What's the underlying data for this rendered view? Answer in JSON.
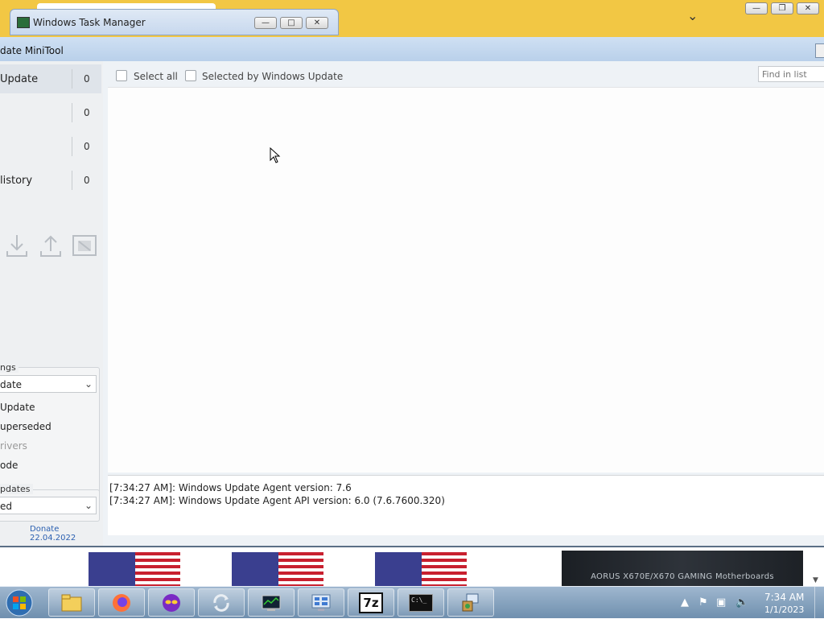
{
  "taskmgr": {
    "title": "Windows Task Manager"
  },
  "app": {
    "title": "date MiniTool",
    "sidebar": {
      "items": [
        {
          "label": " Update",
          "count": "0"
        },
        {
          "label": "",
          "count": "0"
        },
        {
          "label": "",
          "count": "0"
        },
        {
          "label": "listory",
          "count": "0"
        }
      ],
      "settings": {
        "label": "ngs",
        "mode_selected": "date",
        "options": [
          " Update",
          "uperseded",
          "rivers",
          "ode"
        ]
      },
      "updates": {
        "label": "pdates",
        "selected": "ed"
      },
      "donate": "Donate",
      "date": "22.04.2022"
    },
    "toolbar": {
      "select_all": "Select all",
      "selected_by_wu": "Selected by Windows Update",
      "find_placeholder": "Find in list"
    },
    "log": [
      "[7:34:27 AM]: Windows Update Agent version: 7.6",
      "[7:34:27 AM]: Windows Update Agent API version: 6.0 (7.6.7600.320)"
    ]
  },
  "web": {
    "aorus_banner": "AORUS X670E/X670 GAMING Motherboards"
  },
  "taskbar": {
    "apps": [
      "file-explorer-icon",
      "firefox-icon",
      "mask-app-icon",
      "sync-icon",
      "task-manager-icon",
      "control-panel-icon",
      "7zip-icon",
      "cmd-icon",
      "installer-icon"
    ],
    "sevenzip_label": "7z",
    "cmd_label": "C:\\_",
    "clock_time": "7:34 AM",
    "clock_date": "1/1/2023"
  },
  "colors": {
    "accent": "#f2c744",
    "titlebar": "#b9d0ea",
    "taskbar": "#6f8fae"
  }
}
